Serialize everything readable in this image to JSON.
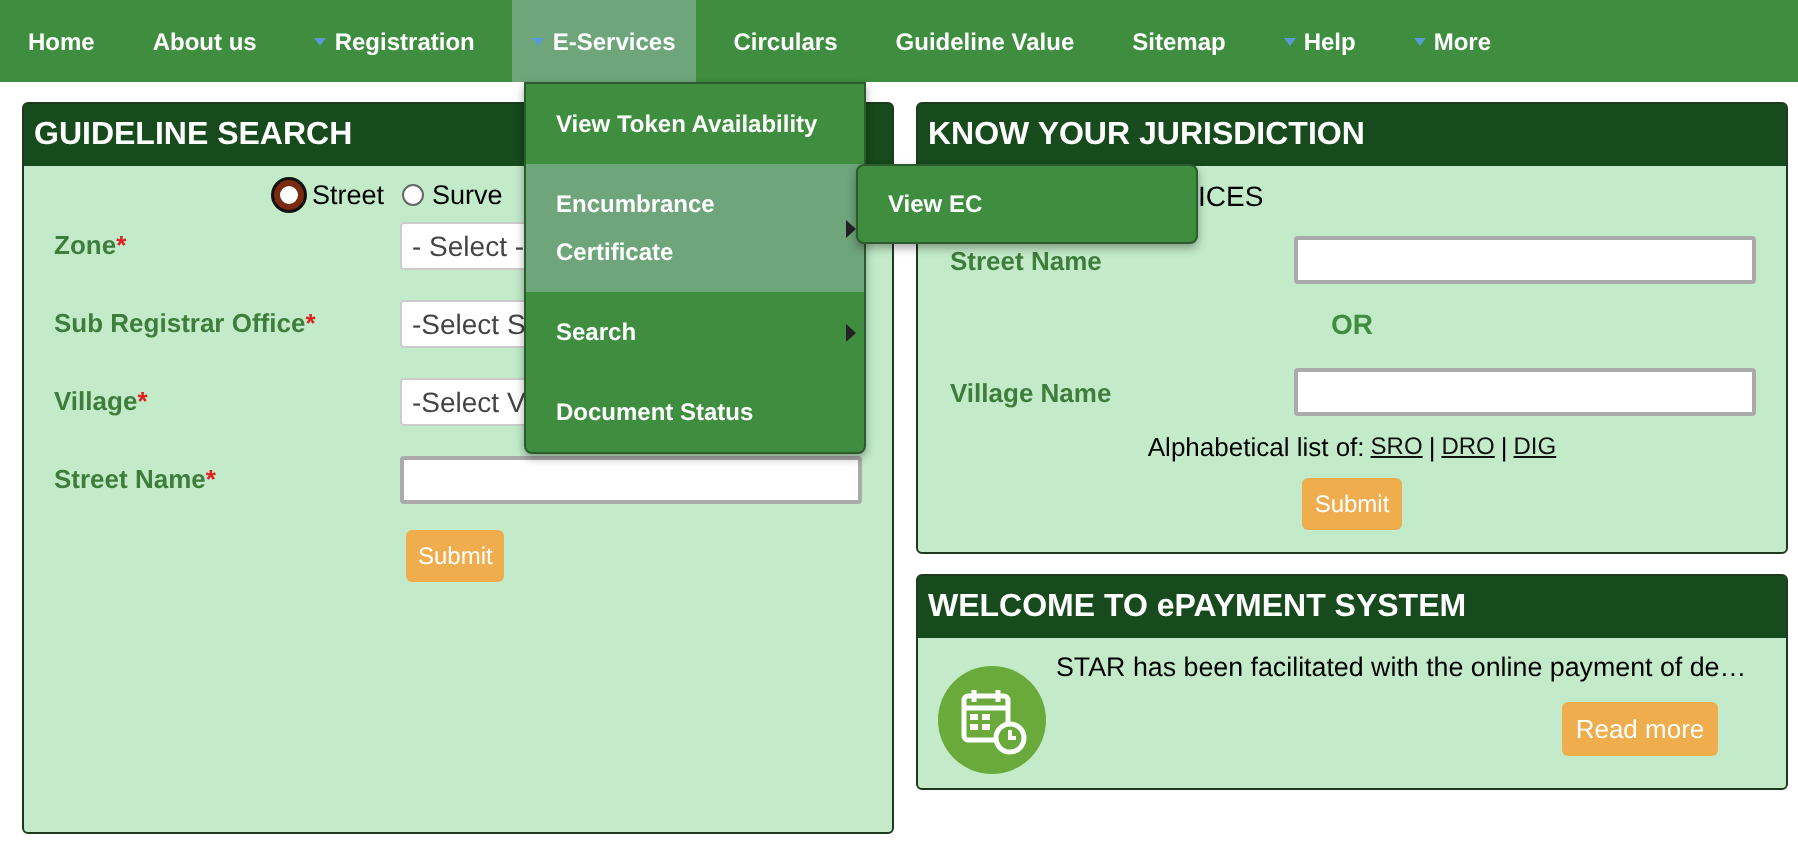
{
  "nav": [
    {
      "label": "Home",
      "has_submenu": false,
      "selected": false
    },
    {
      "label": "About us",
      "has_submenu": false,
      "selected": false
    },
    {
      "label": "Registration",
      "has_submenu": true,
      "selected": false
    },
    {
      "label": "E-Services",
      "has_submenu": true,
      "selected": true
    },
    {
      "label": "Circulars",
      "has_submenu": false,
      "selected": false
    },
    {
      "label": "Guideline Value",
      "has_submenu": false,
      "selected": false
    },
    {
      "label": "Sitemap",
      "has_submenu": false,
      "selected": false
    },
    {
      "label": "Help",
      "has_submenu": true,
      "selected": false
    },
    {
      "label": "More",
      "has_submenu": true,
      "selected": false
    }
  ],
  "dropdown": {
    "items": [
      {
        "label": "View Token Availability",
        "has_submenu": false,
        "selected": false
      },
      {
        "label": "Encumbrance Certificate",
        "has_submenu": true,
        "selected": true
      },
      {
        "label": "Search",
        "has_submenu": true,
        "selected": false
      },
      {
        "label": "Document Status",
        "has_submenu": false,
        "selected": false
      }
    ],
    "submenu": {
      "items": [
        {
          "label": "View EC"
        }
      ]
    }
  },
  "guideline_search": {
    "title": "GUIDELINE SEARCH",
    "search_by": [
      {
        "label": "Street",
        "selected": true
      },
      {
        "label": "Surve",
        "selected": false
      }
    ],
    "fields": [
      {
        "label": "Zone",
        "required_mark": "*",
        "kind": "select",
        "value": "- Select -"
      },
      {
        "label": "Sub Registrar Office",
        "required_mark": "*",
        "kind": "select",
        "value": "-Select S"
      },
      {
        "label": "Village",
        "required_mark": "*",
        "kind": "select",
        "value": "-Select V"
      },
      {
        "label": "Street Name",
        "required_mark": "*",
        "kind": "text"
      }
    ],
    "submit": "Submit"
  },
  "jurisdiction": {
    "title": "KNOW YOUR JURISDICTION",
    "subtitle": "ICES",
    "street_label": "Street Name",
    "or": "OR",
    "village_label": "Village Name",
    "list_label": "Alphabetical list of:",
    "links": [
      "SRO",
      "DRO",
      "DIG"
    ],
    "separators": [
      "|",
      "|"
    ],
    "submit": "Submit"
  },
  "epayment": {
    "title": "WELCOME TO ePAYMENT SYSTEM",
    "text": "STAR has been facilitated with the online payment of de…",
    "read_more": "Read more"
  }
}
